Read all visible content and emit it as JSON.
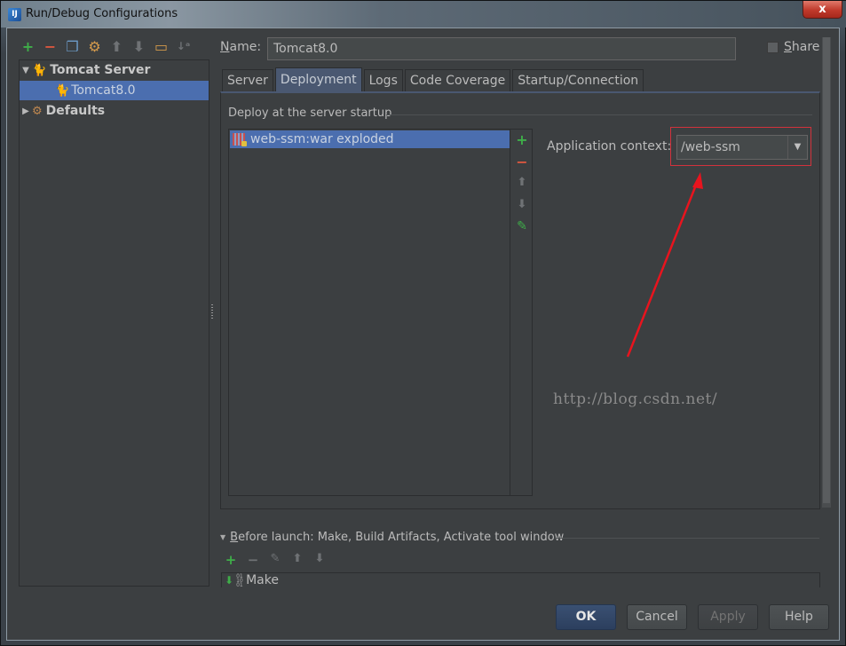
{
  "window": {
    "title": "Run/Debug Configurations",
    "app_icon": "intellij-idea-icon",
    "close_label": "x"
  },
  "left_toolbar": {
    "items": [
      {
        "name": "add-icon",
        "glyph": "+",
        "color": "#3fae49"
      },
      {
        "name": "remove-icon",
        "glyph": "−",
        "color": "#d9573f"
      },
      {
        "name": "copy-icon",
        "glyph": "❐",
        "color": "#6d9bc8"
      },
      {
        "name": "edit-defaults-icon",
        "glyph": "⚙",
        "color": "#d49a4c"
      },
      {
        "name": "move-up-icon",
        "glyph": "⬆",
        "color": "#6f7275"
      },
      {
        "name": "move-down-icon",
        "glyph": "⬇",
        "color": "#6f7275"
      },
      {
        "name": "folder-icon",
        "glyph": "▭",
        "color": "#d49a4c"
      },
      {
        "name": "sort-icon",
        "glyph": "↓ᵃ",
        "color": "#6f7275"
      }
    ]
  },
  "tree": {
    "items": [
      {
        "label": "Tomcat Server",
        "expanded": true,
        "bold": true,
        "level": 0
      },
      {
        "label": "Tomcat8.0",
        "selected": true,
        "level": 1
      },
      {
        "label": "Defaults",
        "expanded": false,
        "bold": true,
        "level": 0
      }
    ]
  },
  "form": {
    "name_label": "Name:",
    "name_value": "Tomcat8.0",
    "share_label": "Share",
    "share_checked": false
  },
  "tabs": [
    {
      "label": "Server",
      "active": false
    },
    {
      "label": "Deployment",
      "active": true
    },
    {
      "label": "Logs",
      "active": false
    },
    {
      "label": "Code Coverage",
      "active": false
    },
    {
      "label": "Startup/Connection",
      "active": false
    }
  ],
  "deployment": {
    "section_title": "Deploy at the server startup",
    "artifacts": [
      "web-ssm:war exploded"
    ],
    "list_toolbar": [
      "add",
      "remove",
      "move-up",
      "move-down",
      "edit"
    ],
    "context_label": "Application context:",
    "context_value": "/web-ssm"
  },
  "watermark": "http://blog.csdn.net/",
  "annotation": {
    "highlight_color": "#d2323c",
    "arrow_color": "#e8141e"
  },
  "before_launch": {
    "title": "Before launch: Make, Build Artifacts, Activate tool window",
    "tasks": [
      "Make"
    ]
  },
  "buttons": {
    "ok": "OK",
    "cancel": "Cancel",
    "apply": "Apply",
    "help": "Help"
  }
}
